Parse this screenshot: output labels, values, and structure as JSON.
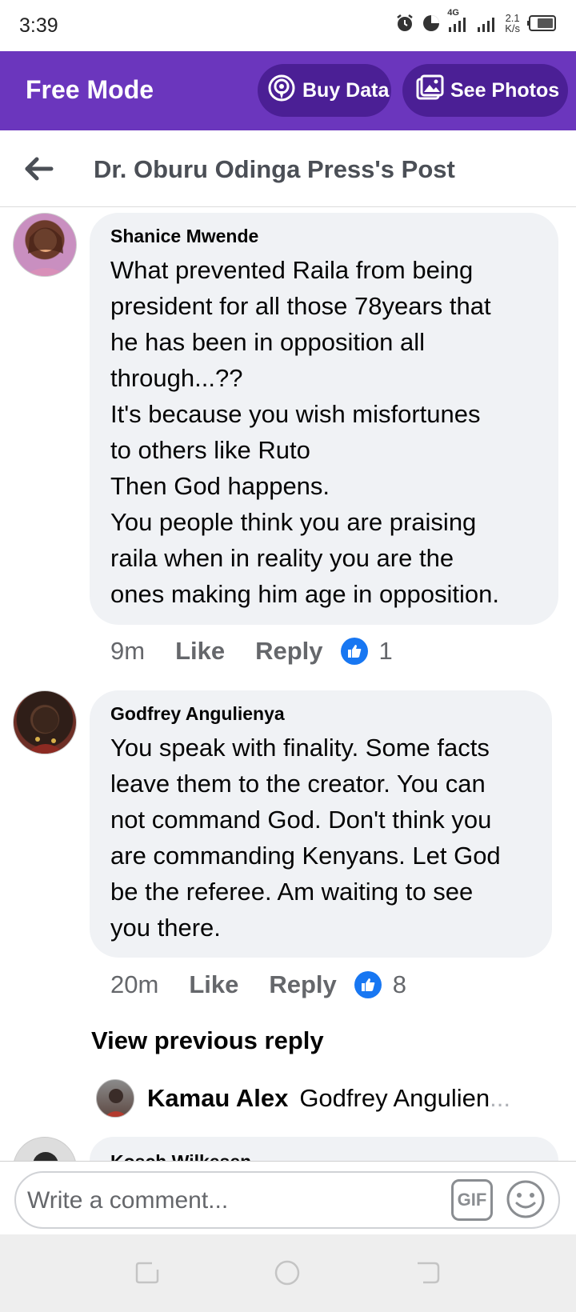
{
  "status_bar": {
    "time": "3:39",
    "network": "4G",
    "speed_value": "2.1",
    "speed_unit": "K/s"
  },
  "mode_bar": {
    "title": "Free Mode",
    "buy_data_label": "Buy Data",
    "see_photos_label": "See Photos",
    "color": "#6b36bd"
  },
  "header": {
    "title": "Dr. Oburu Odinga Press's Post"
  },
  "comments": [
    {
      "author": "Shanice Mwende",
      "lines": [
        "What prevented Raila from being",
        "president for all those 78years that",
        "he has been in opposition all",
        "through...??",
        "It's because you wish misfortunes",
        "to others like Ruto",
        "Then God happens.",
        "You people think you are praising",
        "raila when in reality you are the",
        "ones making him age in opposition."
      ],
      "time": "9m",
      "like_label": "Like",
      "reply_label": "Reply",
      "like_count": "1"
    },
    {
      "author": "Godfrey Angulienya",
      "lines": [
        "You speak with finality. Some facts",
        "leave them to the creator. You can",
        "not command God. Don't think you",
        "are commanding Kenyans. Let God",
        "be the referee. Am waiting to see",
        "you there."
      ],
      "time": "20m",
      "like_label": "Like",
      "reply_label": "Reply",
      "like_count": "8"
    }
  ],
  "view_previous_reply": "View previous reply",
  "reply_preview": {
    "name": "Kamau Alex",
    "text": "Godfrey Angulien",
    "ellipsis": "..."
  },
  "next_comment_author": "Kosch Wilkesen",
  "composer": {
    "placeholder": "Write a comment...",
    "gif_label": "GIF"
  },
  "colors": {
    "like_blue": "#1877f2",
    "bubble": "#f0f2f5"
  }
}
